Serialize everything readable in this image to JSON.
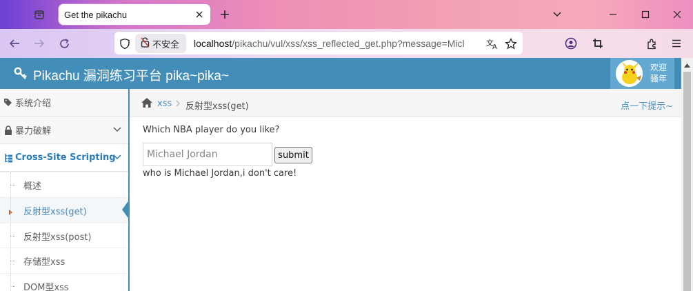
{
  "browser": {
    "tab_title": "Get the pikachu",
    "insecure_label": "不安全",
    "url_host": "localhost",
    "url_path": "/pikachu/vul/xss/xss_reflected_get.php?message=Micl"
  },
  "header": {
    "title": "Pikachu 漏洞练习平台 pika~pika~",
    "welcome_line1": "欢迎",
    "welcome_line2": "骚年"
  },
  "sidebar": {
    "items": [
      {
        "label": "系统介绍"
      },
      {
        "label": "暴力破解"
      },
      {
        "label": "Cross-Site Scripting"
      }
    ],
    "subitems": [
      {
        "label": "概述"
      },
      {
        "label": "反射型xss(get)"
      },
      {
        "label": "反射型xss(post)"
      },
      {
        "label": "存储型xss"
      },
      {
        "label": "DOM型xss"
      }
    ]
  },
  "breadcrumb": {
    "section": "xss",
    "current": "反射型xss(get)",
    "hint": "点一下提示~"
  },
  "form": {
    "question": "Which NBA player do you like?",
    "input_value": "Michael Jordan",
    "submit_label": "submit",
    "result": "who is Michael Jordan,i don't care!"
  },
  "colors": {
    "header_bg": "#438eb9",
    "link": "#4c8fbd",
    "active_menu": "#2b7dbc"
  }
}
